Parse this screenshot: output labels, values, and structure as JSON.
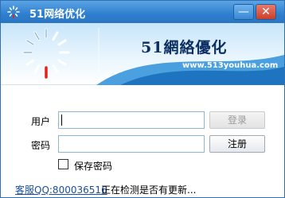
{
  "window": {
    "title": "51网络优化",
    "minimize_glyph": "—",
    "close_glyph": "✕"
  },
  "banner": {
    "brand_name": "51網絡優化",
    "brand_url": "www.513youhua.com",
    "logo_icon": "spinner-logo-icon"
  },
  "form": {
    "user_label": "用户",
    "user_value": "",
    "password_label": "密码",
    "password_value": "",
    "login_button": "登录",
    "register_button": "注册",
    "save_password_label": "保存密码",
    "save_password_checked": false
  },
  "footer": {
    "support_link": "客服QQ:800036516",
    "status": "正在检测是否有更新..."
  },
  "colors": {
    "titlebar": "#2e7fcf",
    "brand": "#0d2f63",
    "link": "#1a4fa0",
    "close": "#c8402c"
  }
}
